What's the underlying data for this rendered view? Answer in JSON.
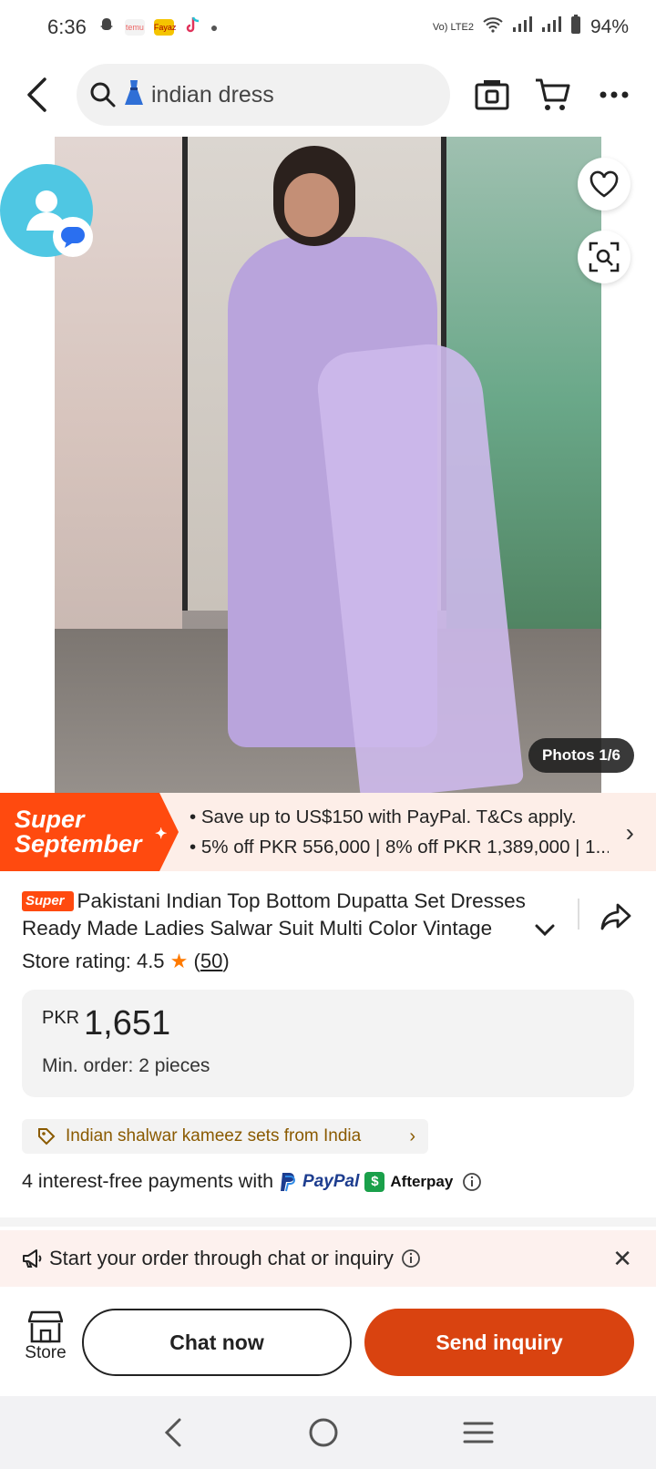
{
  "status_bar": {
    "time": "6:36",
    "network": "Vo) LTE2",
    "battery": "94%",
    "app_labels": [
      "temu",
      "Fayaz"
    ]
  },
  "search": {
    "query": "indian dress"
  },
  "gallery": {
    "photos_label": "Photos 1/6"
  },
  "promo": {
    "badge_line1": "Super",
    "badge_line2": "September",
    "line1": "• Save up to US$150 with PayPal. T&Cs apply.",
    "line2": "• 5% off PKR 556,000 | 8% off PKR 1,389,000 | 1..."
  },
  "product": {
    "super_tag": "Super",
    "title": "Pakistani Indian Top Bottom Dupatta Set Dresses Ready Made Ladies Salwar Suit Multi Color Vintage",
    "store_rating_label": "Store rating: 4.5",
    "rating_count": "50",
    "currency": "PKR",
    "price": "1,651",
    "min_order": "Min. order: 2 pieces",
    "category": "Indian shalwar kameez sets from India"
  },
  "payment": {
    "text": "4 interest-free payments with",
    "paypal": "PayPal",
    "afterpay": "Afterpay"
  },
  "chat_notice": {
    "text": "Start your order through chat or inquiry"
  },
  "actions": {
    "store_label": "Store",
    "chat_label": "Chat now",
    "inquiry_label": "Send inquiry"
  },
  "colors": {
    "accent": "#d94310",
    "promo_orange": "#ff4a0f",
    "contact_blue": "#4fc7e3",
    "category_text": "#8a5a00"
  },
  "icons": [
    "back-arrow-icon",
    "search-icon",
    "dress-emoji-icon",
    "camera-search-icon",
    "cart-icon",
    "more-icon",
    "heart-icon",
    "visual-search-icon",
    "chevron-right-icon",
    "chevron-down-icon",
    "share-icon",
    "star-icon",
    "info-icon",
    "megaphone-icon",
    "close-icon",
    "store-icon"
  ]
}
